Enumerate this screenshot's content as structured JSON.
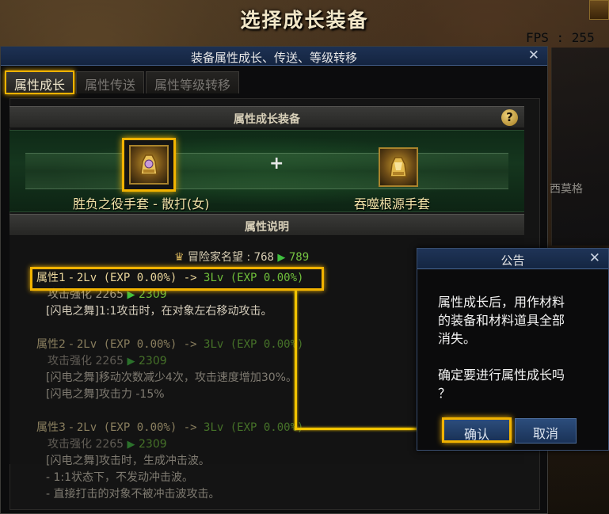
{
  "scene": {
    "title": "选择成长装备",
    "fps": "FPS : 255",
    "bg_text": "西莫格"
  },
  "window": {
    "title": "装备属性成长、传送、等级转移",
    "tabs": [
      {
        "label": "属性成长",
        "active": true
      },
      {
        "label": "属性传送",
        "active": false
      },
      {
        "label": "属性等级转移",
        "active": false
      }
    ],
    "section_equipment": "属性成长装备",
    "section_description": "属性说明",
    "help_icon": "?"
  },
  "equipment": {
    "left_item": {
      "name": "胜负之役手套 - 散打(女)",
      "icon": "gauntlet-icon"
    },
    "plus": "+",
    "right_item": {
      "name": "吞噬根源手套",
      "icon": "gauntlet-icon"
    }
  },
  "fame": {
    "label": "冒险家名望 : ",
    "old": "768",
    "new": "789"
  },
  "attributes": [
    {
      "head_label": "属性1 - ",
      "from": "2Lv (EXP 0.00%)",
      "arrow": " -> ",
      "to": "3Lv (EXP 0.00%)",
      "sub_label": "攻击强化 ",
      "sub_old": "2265",
      "sub_new": "2309",
      "lines": [
        "[闪电之舞]1:1攻击时，在对象左右移动攻击。"
      ]
    },
    {
      "head_label": "属性2 - ",
      "from": "2Lv (EXP 0.00%)",
      "arrow": " -> ",
      "to": "3Lv (EXP 0.00%)",
      "sub_label": "攻击强化 ",
      "sub_old": "2265",
      "sub_new": "2309",
      "lines": [
        "[闪电之舞]移动次数减少4次，攻击速度增加30%。",
        "[闪电之舞]攻击力 -15%"
      ]
    },
    {
      "head_label": "属性3 - ",
      "from": "2Lv (EXP 0.00%)",
      "arrow": " -> ",
      "to": "3Lv (EXP 0.00%)",
      "sub_label": "攻击强化 ",
      "sub_old": "2265",
      "sub_new": "2309",
      "lines": [
        "[闪电之舞]攻击时，生成冲击波。",
        "- 1:1状态下，不发动冲击波。",
        "- 直接打击的对象不被冲击波攻击。"
      ]
    }
  ],
  "dialog": {
    "title": "公告",
    "message_line1": "属性成长后，用作材料",
    "message_line2": "的装备和材料道具全部",
    "message_line3": "消失。",
    "message_line4": "",
    "message_line5": "确定要进行属性成长吗",
    "message_line6": "？",
    "confirm_label": "确认",
    "cancel_label": "取消"
  },
  "colors": {
    "highlight": "#f2b300",
    "titlebar": "#1d3153",
    "increase": "#6fbf3a"
  }
}
